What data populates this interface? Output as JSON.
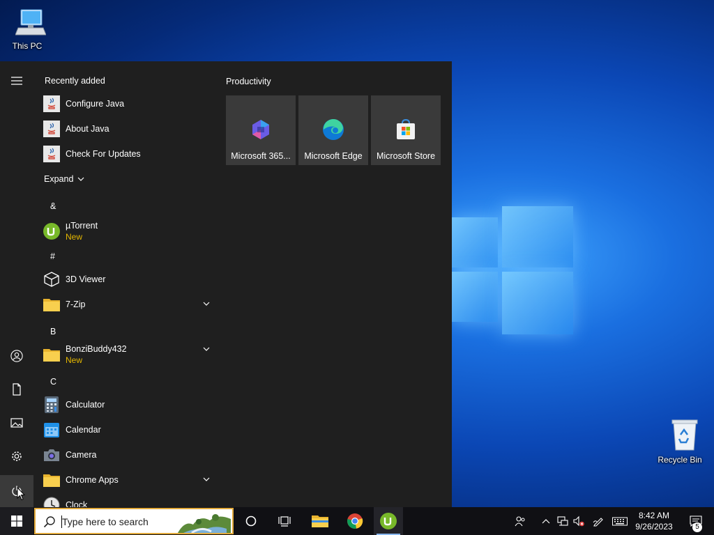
{
  "desktop": {
    "this_pc": "This PC",
    "recycle_bin": "Recycle Bin"
  },
  "start_menu": {
    "recently_added": "Recently added",
    "recent": [
      {
        "name": "Configure Java",
        "icon": "java-icon"
      },
      {
        "name": "About Java",
        "icon": "java-icon"
      },
      {
        "name": "Check For Updates",
        "icon": "java-icon"
      }
    ],
    "expand": "Expand",
    "groups": {
      "amp": "&",
      "hash": "#",
      "b": "B",
      "c": "C"
    },
    "apps": {
      "utorrent": {
        "name": "µTorrent",
        "badge": "New"
      },
      "viewer3d": {
        "name": "3D Viewer"
      },
      "zip": {
        "name": "7-Zip"
      },
      "bonzi": {
        "name": "BonziBuddy432",
        "badge": "New"
      },
      "calculator": {
        "name": "Calculator"
      },
      "calendar": {
        "name": "Calendar"
      },
      "camera": {
        "name": "Camera"
      },
      "chrome_apps": {
        "name": "Chrome Apps"
      },
      "clock": {
        "name": "Clock"
      }
    },
    "productivity": {
      "header": "Productivity",
      "tiles": [
        {
          "label": "Microsoft 365...",
          "icon": "microsoft-365-icon"
        },
        {
          "label": "Microsoft Edge",
          "icon": "edge-icon"
        },
        {
          "label": "Microsoft Store",
          "icon": "store-icon"
        }
      ]
    },
    "badge_color": "#e6b800"
  },
  "taskbar": {
    "search_placeholder": "Type here to search",
    "time": "8:42 AM",
    "date": "9/26/2023",
    "notification_count": "5"
  }
}
